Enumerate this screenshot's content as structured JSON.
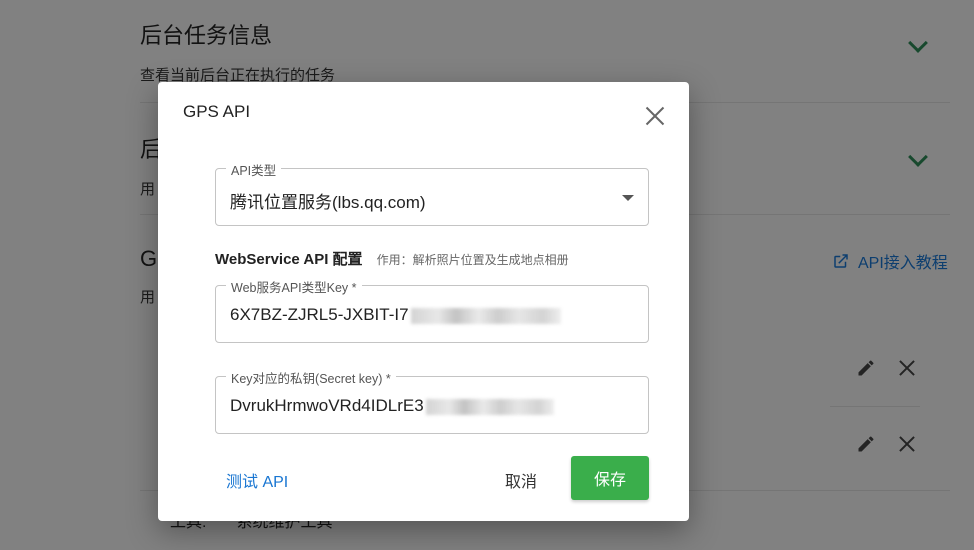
{
  "background": {
    "sections": [
      {
        "title": "后台任务信息",
        "desc": "查看当前后台正在执行的任务"
      },
      {
        "title": "后",
        "desc": "用"
      },
      {
        "title": "G",
        "desc": "用"
      }
    ],
    "tutorial_link": "API接入教程",
    "bottom_text_left": "工具:",
    "bottom_text_right": "系统维护工具"
  },
  "dialog": {
    "title": "GPS API",
    "api_type": {
      "label": "API类型",
      "value": "腾讯位置服务(lbs.qq.com)"
    },
    "section": {
      "title": "WebService API 配置",
      "note": "作用：解析照片位置及生成地点相册"
    },
    "key_field": {
      "label": "Web服务API类型Key *",
      "value": "6X7BZ-ZJRL5-JXBIT-I7"
    },
    "secret_field": {
      "label": "Key对应的私钥(Secret key) *",
      "value": "DvrukHrmwoVRd4IDLrE3"
    },
    "test_label": "测试 API",
    "cancel_label": "取消",
    "save_label": "保存"
  },
  "colors": {
    "accent": "#1976d2",
    "save": "#3aae4b",
    "chevron": "#2e8b57"
  }
}
